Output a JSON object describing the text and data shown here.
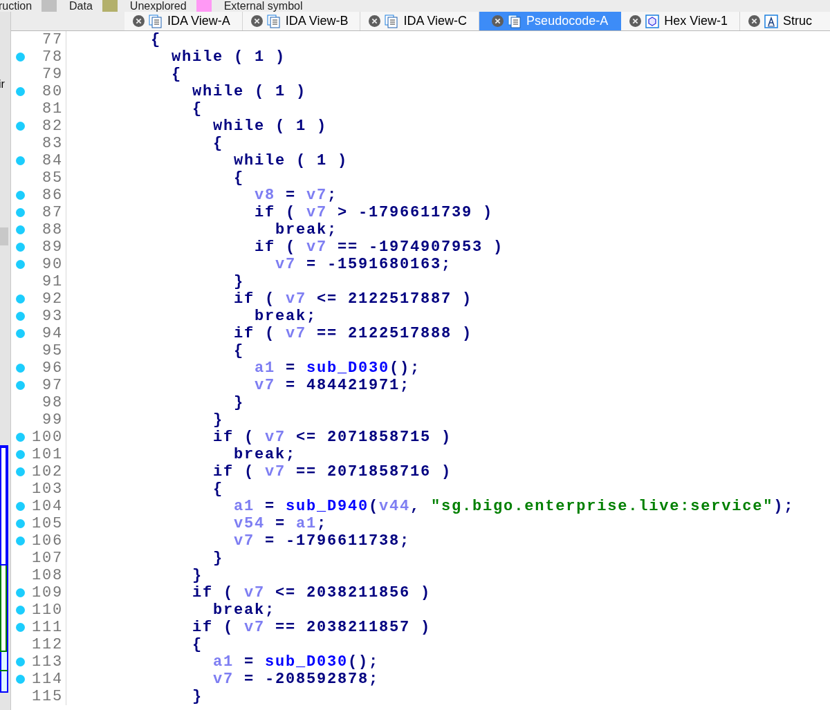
{
  "legend": [
    {
      "label": "ruction",
      "color": "#c0c0c0"
    },
    {
      "label": "Data",
      "color": "#b3b06b"
    },
    {
      "label": "Unexplored",
      "color": "#ff99f5"
    },
    {
      "label": "External symbol"
    }
  ],
  "side_panel": {
    "text": "ir"
  },
  "tabs": [
    {
      "label": "IDA View-A",
      "kind": "listing",
      "selected": false
    },
    {
      "label": "IDA View-B",
      "kind": "listing",
      "selected": false
    },
    {
      "label": "IDA View-C",
      "kind": "listing",
      "selected": false
    },
    {
      "label": "Pseudocode-A",
      "kind": "listing",
      "selected": true
    },
    {
      "label": "Hex View-1",
      "kind": "hex",
      "selected": false
    },
    {
      "label": "Struc",
      "kind": "struct",
      "selected": false
    }
  ],
  "lines": [
    {
      "number": "77",
      "breakpoint": false,
      "tokens": [
        {
          "kind": "plain",
          "text": "{"
        }
      ],
      "children": [
        {
          "number": "78",
          "breakpoint": true,
          "tokens": [
            {
              "kind": "plain",
              "text": "while ( 1 )"
            }
          ]
        },
        {
          "number": "79",
          "breakpoint": false,
          "tokens": [
            {
              "kind": "plain",
              "text": "{"
            }
          ],
          "children": [
            {
              "number": "80",
              "breakpoint": true,
              "tokens": [
                {
                  "kind": "plain",
                  "text": "while ( 1 )"
                }
              ]
            },
            {
              "number": "81",
              "breakpoint": false,
              "tokens": [
                {
                  "kind": "plain",
                  "text": "{"
                }
              ],
              "children": [
                {
                  "number": "82",
                  "breakpoint": true,
                  "tokens": [
                    {
                      "kind": "plain",
                      "text": "while ( 1 )"
                    }
                  ]
                },
                {
                  "number": "83",
                  "breakpoint": false,
                  "tokens": [
                    {
                      "kind": "plain",
                      "text": "{"
                    }
                  ],
                  "children": [
                    {
                      "number": "84",
                      "breakpoint": true,
                      "tokens": [
                        {
                          "kind": "plain",
                          "text": "while ( 1 )"
                        }
                      ]
                    },
                    {
                      "number": "85",
                      "breakpoint": false,
                      "tokens": [
                        {
                          "kind": "plain",
                          "text": "{"
                        }
                      ],
                      "children": [
                        {
                          "number": "86",
                          "breakpoint": true,
                          "tokens": [
                            {
                              "kind": "var",
                              "text": "v8"
                            },
                            {
                              "kind": "plain",
                              "text": " = "
                            },
                            {
                              "kind": "var",
                              "text": "v7"
                            },
                            {
                              "kind": "plain",
                              "text": ";"
                            }
                          ]
                        },
                        {
                          "number": "87",
                          "breakpoint": true,
                          "tokens": [
                            {
                              "kind": "plain",
                              "text": "if ( "
                            },
                            {
                              "kind": "var",
                              "text": "v7"
                            },
                            {
                              "kind": "plain",
                              "text": " > -1796611739 )"
                            }
                          ],
                          "children": [
                            {
                              "number": "88",
                              "breakpoint": true,
                              "tokens": [
                                {
                                  "kind": "plain",
                                  "text": "break;"
                                }
                              ]
                            }
                          ]
                        },
                        {
                          "number": "89",
                          "breakpoint": true,
                          "tokens": [
                            {
                              "kind": "plain",
                              "text": "if ( "
                            },
                            {
                              "kind": "var",
                              "text": "v7"
                            },
                            {
                              "kind": "plain",
                              "text": " == -1974907953 )"
                            }
                          ],
                          "children": [
                            {
                              "number": "90",
                              "breakpoint": true,
                              "tokens": [
                                {
                                  "kind": "var",
                                  "text": "v7"
                                },
                                {
                                  "kind": "plain",
                                  "text": " = -1591680163;"
                                }
                              ]
                            }
                          ]
                        }
                      ]
                    },
                    {
                      "number": "91",
                      "breakpoint": false,
                      "tokens": [
                        {
                          "kind": "plain",
                          "text": "}"
                        }
                      ]
                    },
                    {
                      "number": "92",
                      "breakpoint": true,
                      "tokens": [
                        {
                          "kind": "plain",
                          "text": "if ( "
                        },
                        {
                          "kind": "var",
                          "text": "v7"
                        },
                        {
                          "kind": "plain",
                          "text": " <= 2122517887 )"
                        }
                      ],
                      "children": [
                        {
                          "number": "93",
                          "breakpoint": true,
                          "tokens": [
                            {
                              "kind": "plain",
                              "text": "break;"
                            }
                          ]
                        }
                      ]
                    },
                    {
                      "number": "94",
                      "breakpoint": true,
                      "tokens": [
                        {
                          "kind": "plain",
                          "text": "if ( "
                        },
                        {
                          "kind": "var",
                          "text": "v7"
                        },
                        {
                          "kind": "plain",
                          "text": " == 2122517888 )"
                        }
                      ]
                    },
                    {
                      "number": "95",
                      "breakpoint": false,
                      "tokens": [
                        {
                          "kind": "plain",
                          "text": "{"
                        }
                      ],
                      "children": [
                        {
                          "number": "96",
                          "breakpoint": true,
                          "tokens": [
                            {
                              "kind": "var",
                              "text": "a1"
                            },
                            {
                              "kind": "plain",
                              "text": " = "
                            },
                            {
                              "kind": "func",
                              "text": "sub_D030"
                            },
                            {
                              "kind": "plain",
                              "text": "();"
                            }
                          ]
                        },
                        {
                          "number": "97",
                          "breakpoint": true,
                          "tokens": [
                            {
                              "kind": "var",
                              "text": "v7"
                            },
                            {
                              "kind": "plain",
                              "text": " = 484421971;"
                            }
                          ]
                        }
                      ]
                    },
                    {
                      "number": "98",
                      "breakpoint": false,
                      "tokens": [
                        {
                          "kind": "plain",
                          "text": "}"
                        }
                      ]
                    }
                  ]
                },
                {
                  "number": "99",
                  "breakpoint": false,
                  "tokens": [
                    {
                      "kind": "plain",
                      "text": "}"
                    }
                  ]
                },
                {
                  "number": "100",
                  "breakpoint": true,
                  "tokens": [
                    {
                      "kind": "plain",
                      "text": "if ( "
                    },
                    {
                      "kind": "var",
                      "text": "v7"
                    },
                    {
                      "kind": "plain",
                      "text": " <= 2071858715 )"
                    }
                  ],
                  "children": [
                    {
                      "number": "101",
                      "breakpoint": true,
                      "tokens": [
                        {
                          "kind": "plain",
                          "text": "break;"
                        }
                      ]
                    }
                  ]
                },
                {
                  "number": "102",
                  "breakpoint": true,
                  "tokens": [
                    {
                      "kind": "plain",
                      "text": "if ( "
                    },
                    {
                      "kind": "var",
                      "text": "v7"
                    },
                    {
                      "kind": "plain",
                      "text": " == 2071858716 )"
                    }
                  ]
                },
                {
                  "number": "103",
                  "breakpoint": false,
                  "tokens": [
                    {
                      "kind": "plain",
                      "text": "{"
                    }
                  ],
                  "children": [
                    {
                      "number": "104",
                      "breakpoint": true,
                      "tokens": [
                        {
                          "kind": "var",
                          "text": "a1"
                        },
                        {
                          "kind": "plain",
                          "text": " = "
                        },
                        {
                          "kind": "func",
                          "text": "sub_D940"
                        },
                        {
                          "kind": "plain",
                          "text": "("
                        },
                        {
                          "kind": "var",
                          "text": "v44"
                        },
                        {
                          "kind": "plain",
                          "text": ", "
                        },
                        {
                          "kind": "string",
                          "text": "\"sg.bigo.enterprise.live:service\""
                        },
                        {
                          "kind": "plain",
                          "text": ");"
                        }
                      ]
                    },
                    {
                      "number": "105",
                      "breakpoint": true,
                      "tokens": [
                        {
                          "kind": "var",
                          "text": "v54"
                        },
                        {
                          "kind": "plain",
                          "text": " = "
                        },
                        {
                          "kind": "var",
                          "text": "a1"
                        },
                        {
                          "kind": "plain",
                          "text": ";"
                        }
                      ]
                    },
                    {
                      "number": "106",
                      "breakpoint": true,
                      "tokens": [
                        {
                          "kind": "var",
                          "text": "v7"
                        },
                        {
                          "kind": "plain",
                          "text": " = -1796611738;"
                        }
                      ]
                    }
                  ]
                },
                {
                  "number": "107",
                  "breakpoint": false,
                  "tokens": [
                    {
                      "kind": "plain",
                      "text": "}"
                    }
                  ]
                }
              ]
            },
            {
              "number": "108",
              "breakpoint": false,
              "tokens": [
                {
                  "kind": "plain",
                  "text": "}"
                }
              ]
            },
            {
              "number": "109",
              "breakpoint": true,
              "tokens": [
                {
                  "kind": "plain",
                  "text": "if ( "
                },
                {
                  "kind": "var",
                  "text": "v7"
                },
                {
                  "kind": "plain",
                  "text": " <= 2038211856 )"
                }
              ],
              "children": [
                {
                  "number": "110",
                  "breakpoint": true,
                  "tokens": [
                    {
                      "kind": "plain",
                      "text": "break;"
                    }
                  ]
                }
              ]
            },
            {
              "number": "111",
              "breakpoint": true,
              "tokens": [
                {
                  "kind": "plain",
                  "text": "if ( "
                },
                {
                  "kind": "var",
                  "text": "v7"
                },
                {
                  "kind": "plain",
                  "text": " == 2038211857 )"
                }
              ]
            },
            {
              "number": "112",
              "breakpoint": false,
              "tokens": [
                {
                  "kind": "plain",
                  "text": "{"
                }
              ],
              "children": [
                {
                  "number": "113",
                  "breakpoint": true,
                  "tokens": [
                    {
                      "kind": "var",
                      "text": "a1"
                    },
                    {
                      "kind": "plain",
                      "text": " = "
                    },
                    {
                      "kind": "func",
                      "text": "sub_D030"
                    },
                    {
                      "kind": "plain",
                      "text": "();"
                    }
                  ]
                },
                {
                  "number": "114",
                  "breakpoint": true,
                  "tokens": [
                    {
                      "kind": "var",
                      "text": "v7"
                    },
                    {
                      "kind": "plain",
                      "text": " = -208592878;"
                    }
                  ]
                }
              ]
            },
            {
              "number": "115",
              "breakpoint": false,
              "tokens": [
                {
                  "kind": "plain",
                  "text": "}"
                }
              ]
            }
          ]
        }
      ]
    }
  ]
}
